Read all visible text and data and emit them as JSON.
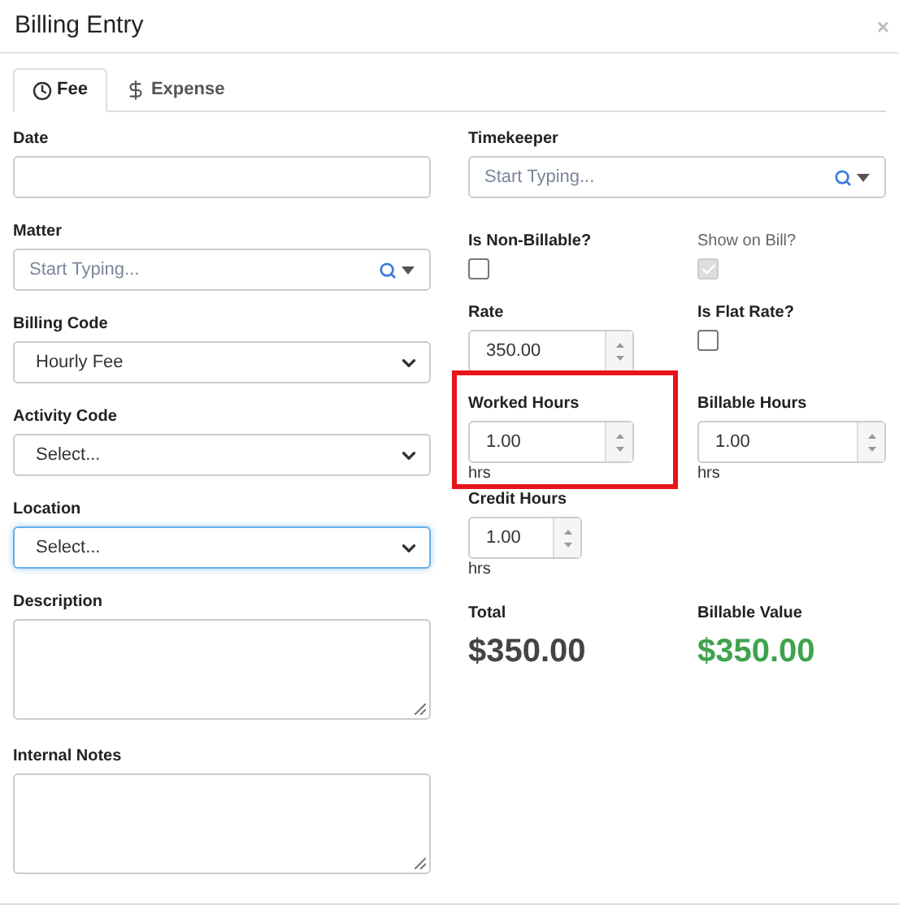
{
  "dialog": {
    "title": "Billing Entry",
    "close": "×"
  },
  "tabs": [
    {
      "label": "Fee",
      "selected": true
    },
    {
      "label": "Expense",
      "selected": false
    }
  ],
  "left_fields": [
    {
      "kind": "text",
      "label": "Date"
    },
    {
      "kind": "search",
      "label": "Matter",
      "placeholder": "Start Typing..."
    },
    {
      "kind": "select",
      "label": "Billing Code",
      "value": "Hourly Fee",
      "focused": false
    },
    {
      "kind": "select",
      "label": "Activity Code",
      "value": "Select...",
      "focused": false
    },
    {
      "kind": "select",
      "label": "Location",
      "value": "Select...",
      "focused": true
    },
    {
      "kind": "textarea",
      "label": "Description"
    },
    {
      "kind": "textarea",
      "label": "Internal Notes"
    }
  ],
  "timekeeper": {
    "label": "Timekeeper",
    "placeholder": "Start Typing..."
  },
  "right_cells": [
    {
      "kind": "checkbox",
      "label": "Is Non-Billable?",
      "checked": false,
      "disabled": false
    },
    {
      "kind": "checkbox",
      "label": "Show on Bill?",
      "checked": true,
      "disabled": true
    },
    {
      "kind": "number",
      "label": "Rate",
      "value": "350.00",
      "highlighted": false
    },
    {
      "kind": "checkbox",
      "label": "Is Flat Rate?",
      "checked": false,
      "disabled": false
    },
    {
      "kind": "number",
      "label": "Worked Hours",
      "value": "1.00",
      "unit": "hrs",
      "highlighted": true
    },
    {
      "kind": "number",
      "label": "Billable Hours",
      "value": "1.00",
      "unit": "hrs",
      "highlighted": false
    },
    {
      "kind": "number",
      "label": "Credit Hours",
      "value": "1.00",
      "unit": "hrs",
      "highlighted": false
    }
  ],
  "totals": [
    {
      "label": "Total",
      "value": "$350.00",
      "color": "#444444"
    },
    {
      "label": "Billable Value",
      "value": "$350.00",
      "color": "#3fa34d"
    }
  ]
}
